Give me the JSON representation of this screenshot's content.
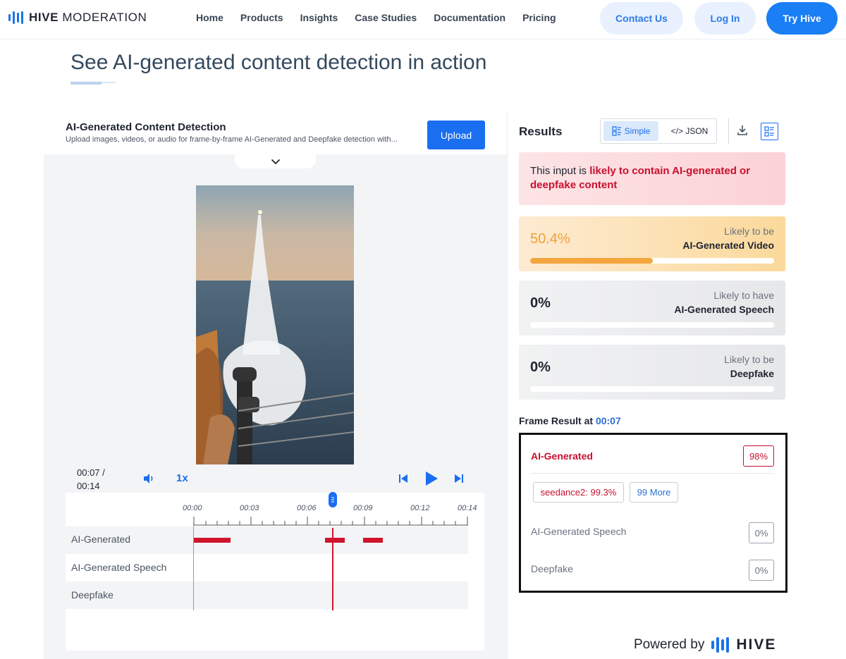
{
  "nav": {
    "logo_bold": "HIVE",
    "logo_light": "MODERATION",
    "links": [
      "Home",
      "Products",
      "Insights",
      "Case Studies",
      "Documentation",
      "Pricing"
    ],
    "contact": "Contact Us",
    "login": "Log In",
    "try": "Try Hive"
  },
  "page_title": "See AI-generated content detection in action",
  "detector": {
    "title": "AI-Generated Content Detection",
    "subtitle": "Upload images, videos, or audio for frame-by-frame AI-Generated and Deepfake detection with...",
    "upload": "Upload"
  },
  "player": {
    "time_current": "00:07 /",
    "time_total": "00:14",
    "speed": "1x",
    "ticks": [
      "00:00",
      "00:03",
      "00:06",
      "00:09",
      "00:12",
      "00:14"
    ],
    "tracks": [
      "AI-Generated",
      "AI-Generated Speech",
      "Deepfake"
    ]
  },
  "results": {
    "title": "Results",
    "simple": "Simple",
    "json": "</> JSON",
    "alert_prefix": "This input is ",
    "alert_highlight": "likely to contain AI-generated or deepfake content",
    "cards": [
      {
        "pct": "50.4%",
        "line1": "Likely to be",
        "line2": "AI-Generated Video",
        "fill": 0.504
      },
      {
        "pct": "0%",
        "line1": "Likely to have",
        "line2": "AI-Generated Speech",
        "fill": 0
      },
      {
        "pct": "0%",
        "line1": "Likely to be",
        "line2": "Deepfake",
        "fill": 0
      }
    ],
    "frame_title": "Frame Result at ",
    "frame_time": "00:07",
    "frame": {
      "ai_label": "AI-Generated",
      "ai_pct": "98%",
      "chip_source": "seedance2: 99.3%",
      "chip_more": "99 More",
      "speech_label": "AI-Generated Speech",
      "speech_pct": "0%",
      "deepfake_label": "Deepfake",
      "deepfake_pct": "0%"
    }
  },
  "powered_by": "Powered by",
  "powered_brand": "HIVE"
}
